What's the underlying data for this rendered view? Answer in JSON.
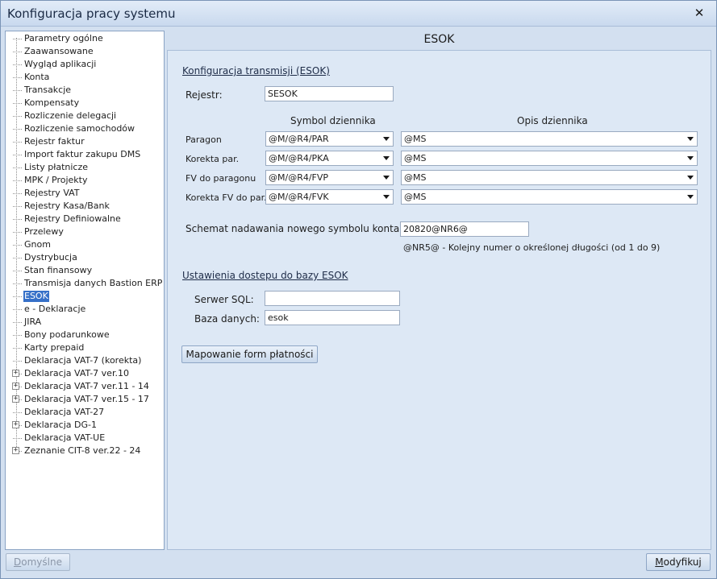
{
  "window": {
    "title": "Konfiguracja pracy systemu",
    "close_glyph": "✕"
  },
  "tree": {
    "items": [
      {
        "label": "Parametry ogólne",
        "expandable": false
      },
      {
        "label": "Zaawansowane",
        "expandable": false
      },
      {
        "label": "Wygląd aplikacji",
        "expandable": false
      },
      {
        "label": "Konta",
        "expandable": false
      },
      {
        "label": "Transakcje",
        "expandable": false
      },
      {
        "label": "Kompensaty",
        "expandable": false
      },
      {
        "label": "Rozliczenie delegacji",
        "expandable": false
      },
      {
        "label": "Rozliczenie samochodów",
        "expandable": false
      },
      {
        "label": "Rejestr faktur",
        "expandable": false
      },
      {
        "label": "Import faktur zakupu DMS",
        "expandable": false
      },
      {
        "label": "Listy płatnicze",
        "expandable": false
      },
      {
        "label": "MPK / Projekty",
        "expandable": false
      },
      {
        "label": "Rejestry VAT",
        "expandable": false
      },
      {
        "label": "Rejestry Kasa/Bank",
        "expandable": false
      },
      {
        "label": "Rejestry Definiowalne",
        "expandable": false
      },
      {
        "label": "Przelewy",
        "expandable": false
      },
      {
        "label": "Gnom",
        "expandable": false
      },
      {
        "label": "Dystrybucja",
        "expandable": false
      },
      {
        "label": "Stan finansowy",
        "expandable": false
      },
      {
        "label": "Transmisja danych Bastion ERP",
        "expandable": false
      },
      {
        "label": "ESOK",
        "expandable": false,
        "selected": true
      },
      {
        "label": "e - Deklaracje",
        "expandable": false
      },
      {
        "label": "JIRA",
        "expandable": false
      },
      {
        "label": "Bony podarunkowe",
        "expandable": false
      },
      {
        "label": "Karty prepaid",
        "expandable": false
      },
      {
        "label": "Deklaracja VAT-7 (korekta)",
        "expandable": false
      },
      {
        "label": "Deklaracja VAT-7 ver.10",
        "expandable": true
      },
      {
        "label": "Deklaracja VAT-7 ver.11 - 14",
        "expandable": true
      },
      {
        "label": "Deklaracja VAT-7 ver.15 - 17",
        "expandable": true
      },
      {
        "label": "Deklaracja VAT-27",
        "expandable": false
      },
      {
        "label": "Deklaracja DG-1",
        "expandable": true
      },
      {
        "label": "Deklaracja VAT-UE",
        "expandable": false
      },
      {
        "label": "Zeznanie CIT-8 ver.22 - 24",
        "expandable": true
      }
    ],
    "expander_glyph": "+"
  },
  "content": {
    "header": "ESOK",
    "transmission_section": "Konfiguracja transmisji  (ESOK)",
    "register_label": "Rejestr:",
    "register_value": "SESOK",
    "col_symbol": "Symbol dziennika",
    "col_description": "Opis dziennika",
    "journals": [
      {
        "label": "Paragon",
        "symbol": "@M/@R4/PAR",
        "description": "@MS"
      },
      {
        "label": "Korekta par.",
        "symbol": "@M/@R4/PKA",
        "description": "@MS"
      },
      {
        "label": "FV do paragonu",
        "symbol": "@M/@R4/FVP",
        "description": "@MS"
      },
      {
        "label": "Korekta FV do par.",
        "symbol": "@M/@R4/FVK",
        "description": "@MS"
      }
    ],
    "scheme_label": "Schemat nadawania nowego symbolu konta:",
    "scheme_value": "20820@NR6@",
    "scheme_hint_code": "@NR5@",
    "scheme_hint_text": " - Kolejny numer o określonej długości (od 1 do 9)",
    "db_section": "Ustawienia dostepu do bazy ESOK",
    "sql_server_label": "Serwer SQL:",
    "sql_server_value": "",
    "database_label": "Baza danych:",
    "database_value": "esok",
    "mapping_button": "Mapowanie form płatności"
  },
  "footer": {
    "default_button": "Domyślne",
    "modify_button": "Modyfikuj"
  }
}
